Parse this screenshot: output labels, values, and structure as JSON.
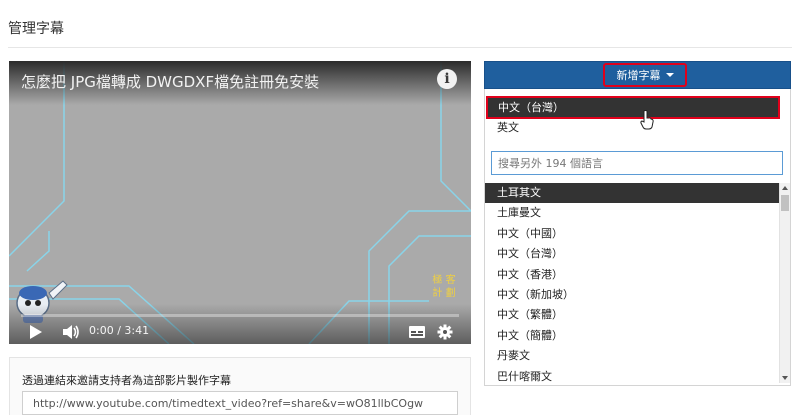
{
  "page": {
    "title": "管理字幕"
  },
  "video": {
    "title": "怎麼把 JPG檔轉成 DWGDXF檔免註冊免安裝",
    "info_icon": "info-icon",
    "watermark": "極 客 計 劃",
    "time": "0:00 / 3:41",
    "progress": 0.0,
    "controls": [
      "play-icon",
      "volume-icon",
      "cc-icon",
      "gear-icon"
    ]
  },
  "invite": {
    "label": "透過連結來邀請支持者為這部影片製作字幕",
    "url": "http://www.youtube.com/timedtext_video?ref=share&v=wO81llbCOgw"
  },
  "subtitles": {
    "add_button_label": "新增字幕",
    "quick_languages": [
      "中文（台灣）",
      "英文"
    ],
    "selected_quick": "中文（台灣）",
    "search_placeholder": "搜尋另外 194 個語言",
    "languages": [
      "土耳其文",
      "土庫曼文",
      "中文（中國）",
      "中文（台灣）",
      "中文（香港）",
      "中文（新加坡）",
      "中文（繁體）",
      "中文（簡體）",
      "丹麥文",
      "巴什喀爾文"
    ],
    "highlighted_language": "土耳其文"
  },
  "colors": {
    "accent_blue": "#1f5f9e",
    "highlight_red": "#e0001b",
    "progress_red": "#e62117",
    "dark_row": "#333333"
  }
}
